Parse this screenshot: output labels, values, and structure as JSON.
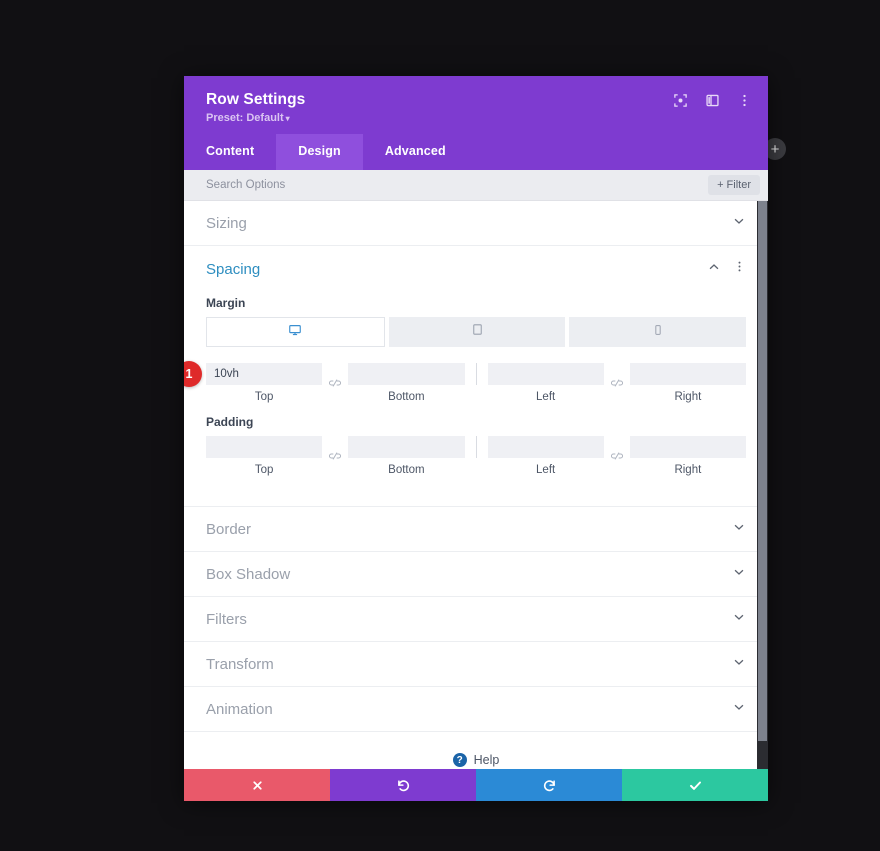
{
  "header": {
    "title": "Row Settings",
    "preset_label": "Preset: Default",
    "preset_caret": "▾",
    "icons": [
      {
        "name": "focus-icon",
        "label": "Focus"
      },
      {
        "name": "panel-layout-icon",
        "label": "Panel Layout"
      },
      {
        "name": "more-vertical-icon",
        "label": "More Options"
      }
    ]
  },
  "tabs": [
    {
      "label": "Content",
      "active": false
    },
    {
      "label": "Design",
      "active": true
    },
    {
      "label": "Advanced",
      "active": false
    }
  ],
  "search": {
    "placeholder": "Search Options",
    "value": "",
    "filter_label": "Filter",
    "filter_plus": "+"
  },
  "sections": [
    {
      "label": "Sizing",
      "state": "collapsed"
    },
    {
      "label": "Spacing",
      "state": "expanded"
    },
    {
      "label": "Border",
      "state": "collapsed"
    },
    {
      "label": "Box Shadow",
      "state": "collapsed"
    },
    {
      "label": "Filters",
      "state": "collapsed"
    },
    {
      "label": "Transform",
      "state": "collapsed"
    },
    {
      "label": "Animation",
      "state": "collapsed"
    }
  ],
  "spacing": {
    "title": "Spacing",
    "devices": [
      {
        "name": "desktop",
        "active": true
      },
      {
        "name": "tablet",
        "active": false
      },
      {
        "name": "phone",
        "active": false
      }
    ],
    "margin": {
      "label": "Margin",
      "badge": "1",
      "fields": [
        {
          "caption": "Top",
          "value": "10vh",
          "placeholder": ""
        },
        {
          "caption": "Bottom",
          "value": "",
          "placeholder": ""
        },
        {
          "caption": "Left",
          "value": "",
          "placeholder": ""
        },
        {
          "caption": "Right",
          "value": "",
          "placeholder": ""
        }
      ]
    },
    "padding": {
      "label": "Padding",
      "fields": [
        {
          "caption": "Top",
          "value": "",
          "placeholder": ""
        },
        {
          "caption": "Bottom",
          "value": "",
          "placeholder": ""
        },
        {
          "caption": "Left",
          "value": "",
          "placeholder": ""
        },
        {
          "caption": "Right",
          "value": "",
          "placeholder": ""
        }
      ]
    }
  },
  "help": {
    "label": "Help",
    "glyph": "?"
  },
  "footer": [
    {
      "name": "cancel",
      "icon": "close-icon",
      "color": "#e9596a"
    },
    {
      "name": "undo",
      "icon": "undo-icon",
      "color": "#7e3bd0"
    },
    {
      "name": "redo",
      "icon": "redo-icon",
      "color": "#2b8ad6"
    },
    {
      "name": "save",
      "icon": "checkmark-icon",
      "color": "#2cc8a0"
    }
  ],
  "add_button": {
    "glyph": "+"
  },
  "colors": {
    "header_purple": "#7e3bd0",
    "tab_active": "#8f4fdd",
    "section_accent": "#2e8ec0",
    "badge_red": "#df2a2a",
    "background": "#111013"
  }
}
